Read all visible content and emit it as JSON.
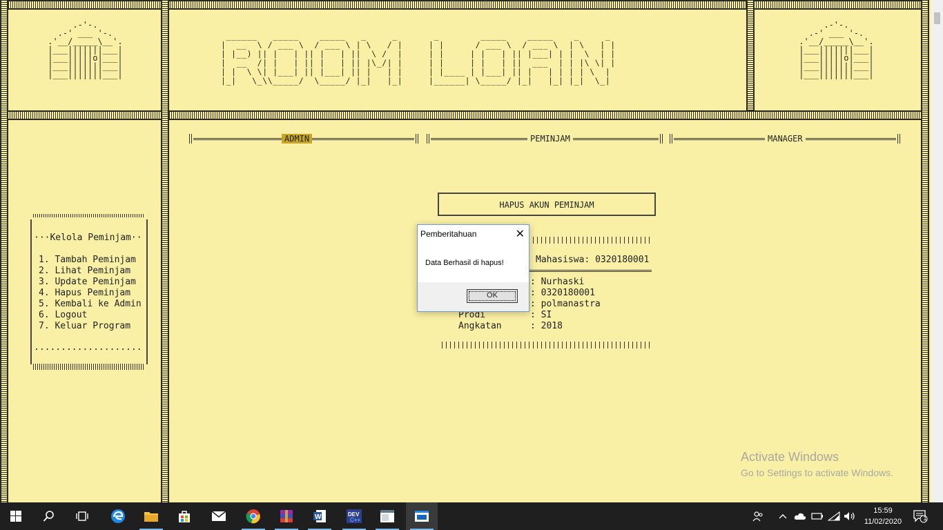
{
  "banner": {
    "title_art": " ______   _____    _____   _     _       _        _____    _____    _     _ \n|  __  \\ / ___ \\  / ___ \\ | \\   / |     | |      / ___ \\  / ___ \\  | \\   | |\n| |__) || |   | || |   | ||  \\ /  |     | |     | |   | || |___| | |  \\  | |\n|  __  /| |   | || |   | || |\\_/| |     | |     | |   | ||  ___  | | |\\ \\| |\n| |  \\ \\| |___| || |___| || |   | |     | |____ | |___| || |   | | | | \\  |\n|_|   \\_\\\\_____/  \\_____/ |_|   |_|     |______| \\_____/ |_|   |_| |_|  \\_|",
    "house_art": "      .-'-.\n   .-' ___ '-.\n .'__/_____\\__'.\n |___|||||||___|\n |___|||||o|___|\n |___|||||||___|\n |___|||||||___|"
  },
  "nav": {
    "admin": "ADMIN",
    "peminjam": "PEMINJAM",
    "manager": "MANAGER"
  },
  "menu": {
    "heading": "···Kelola Peminjam··",
    "items": [
      "1. Tambah Peminjam",
      "2. Lihat Peminjam",
      "3. Update Peminjam",
      "4. Hapus Peminjam",
      "5. Kembali ke Admin",
      "6. Logout",
      "7. Keluar Program"
    ],
    "footer_dots": "...................."
  },
  "main": {
    "title": "HAPUS AKUN PEMINJAM",
    "search_line": "Mahasiswa: 0320180001",
    "rows": [
      {
        "label": "",
        "value": ": Nurhaski"
      },
      {
        "label": "",
        "value": ": 0320180001"
      },
      {
        "label": "",
        "value": ": polmanastra"
      },
      {
        "label": "Prodi",
        "value": ": SI"
      },
      {
        "label": "Angkatan",
        "value": ": 2018"
      }
    ]
  },
  "dialog": {
    "title": "Pemberitahuan",
    "message": "Data Berhasil di hapus!",
    "ok_label": "OK",
    "close_glyph": "✕"
  },
  "watermark": {
    "line1": "Activate Windows",
    "line2": "Go to Settings to activate Windows."
  },
  "taskbar": {
    "time": "15:59",
    "date": "11/02/2020",
    "notification_count": "1",
    "apps": [
      "start-icon",
      "search-icon",
      "task-view-icon",
      "edge-icon",
      "file-explorer-icon",
      "store-icon",
      "mail-icon",
      "chrome-icon",
      "winrar-icon",
      "word-icon",
      "devcpp-icon",
      "app-window-icon",
      "console-app-icon"
    ]
  },
  "colors": {
    "console_bg": "#f9f0a5",
    "nav_active": "#c9a526",
    "taskbar": "#1f1f1f"
  }
}
